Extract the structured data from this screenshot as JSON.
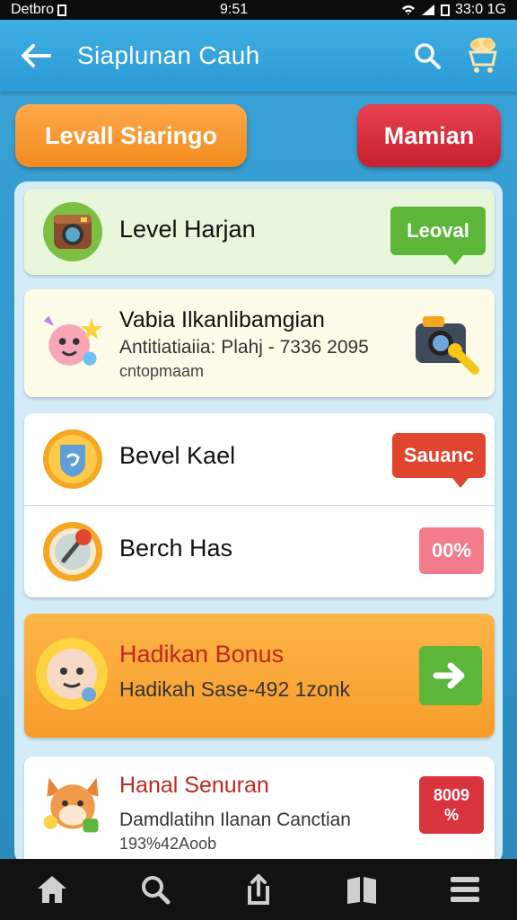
{
  "status_bar": {
    "carrier": "Detbro",
    "time": "9:51",
    "right_text": "33:0 1G"
  },
  "header": {
    "title": "Siaplunan Cauh"
  },
  "top_buttons": {
    "left_label": "Levall Siaringo",
    "right_label": "Mamian"
  },
  "cards": [
    {
      "title": "Level Harjan",
      "badge": "Leoval",
      "badge_color": "#5cb63a",
      "icon": "camera-icon"
    },
    {
      "title": "Vabia Ilkanlibamgian",
      "subtitle": "Antitiatiaiia: Plahj - 7336 2095",
      "subtitle2": "cntopmaam",
      "icon": "party-character-icon",
      "right_icon": "camera-key-icon"
    },
    {
      "title": "Bevel Kael",
      "badge": "Sauanc",
      "badge_color": "#e0452f",
      "icon": "shield-badge-icon"
    },
    {
      "title": "Berch Has",
      "badge": "00%",
      "badge_color": "#f27b8c",
      "icon": "compass-medal-icon"
    },
    {
      "title": "Hadikan Bonus",
      "subtitle": "Hadikah Sase-492 1zonk",
      "icon": "lion-character-icon",
      "action": "arrow-right-icon"
    },
    {
      "title": "Hanal Senuran",
      "subtitle": "Damdlatihn Ilanan Canctian",
      "subtitle2": "193%42Aoob",
      "badge": "8009 %",
      "badge_color": "#d9333d",
      "icon": "fox-character-icon"
    }
  ],
  "colors": {
    "header": "#2c9bd6",
    "accent_orange": "#f59c2b",
    "accent_red": "#c81f2e",
    "green": "#5cb63a"
  },
  "bottom_nav": [
    "home-icon",
    "search-icon",
    "share-icon",
    "book-icon",
    "menu-icon"
  ]
}
